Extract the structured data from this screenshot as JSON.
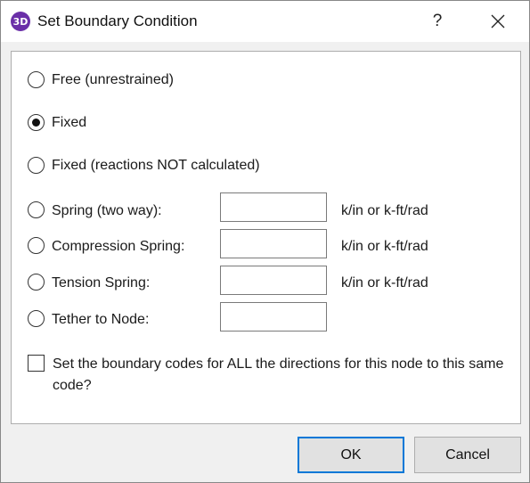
{
  "window": {
    "title": "Set Boundary Condition",
    "app_icon_text": "3D",
    "help_label": "?"
  },
  "options": [
    {
      "label": "Free (unrestrained)",
      "checked": false
    },
    {
      "label": "Fixed",
      "checked": true
    },
    {
      "label": "Fixed (reactions NOT calculated)",
      "checked": false
    },
    {
      "label": "Spring (two way):",
      "checked": false,
      "value": "",
      "unit": "k/in or k-ft/rad"
    },
    {
      "label": "Compression Spring:",
      "checked": false,
      "value": "",
      "unit": "k/in or k-ft/rad"
    },
    {
      "label": "Tension Spring:",
      "checked": false,
      "value": "",
      "unit": "k/in or k-ft/rad"
    },
    {
      "label": "Tether to Node:",
      "checked": false,
      "value": ""
    }
  ],
  "all_directions": {
    "label": "Set the boundary codes for ALL the directions for this node to this same code?",
    "checked": false
  },
  "buttons": {
    "ok": "OK",
    "cancel": "Cancel"
  },
  "colors": {
    "accent": "#0078d7",
    "app_icon": "#6a2fa8"
  }
}
